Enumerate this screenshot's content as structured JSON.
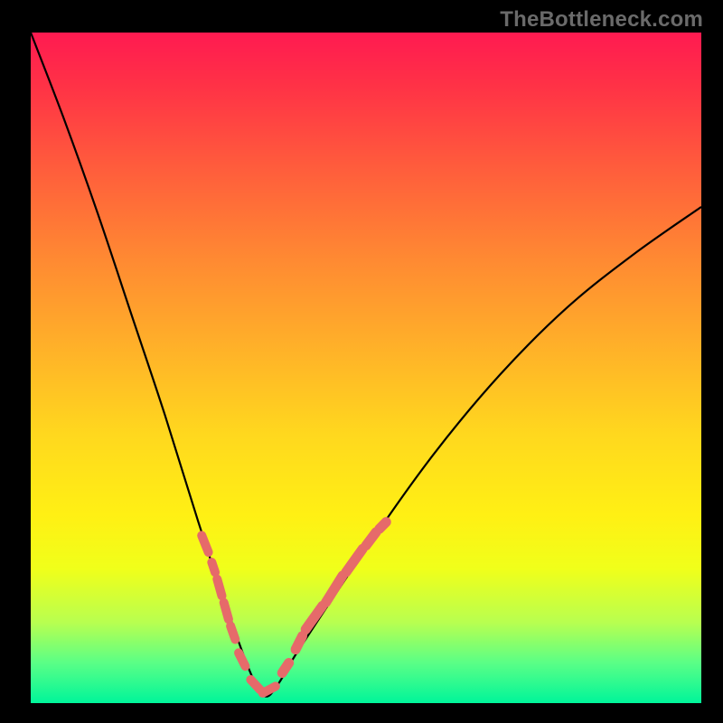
{
  "watermark": "TheBottleneck.com",
  "colors": {
    "gradient_top": "#ff1a51",
    "gradient_bottom": "#00f59a",
    "curve": "#000000",
    "segment": "#e66a6a",
    "frame": "#000000"
  },
  "chart_data": {
    "type": "line",
    "title": "",
    "xlabel": "",
    "ylabel": "",
    "xlim": [
      0,
      100
    ],
    "ylim": [
      0,
      100
    ],
    "x": [
      0,
      5,
      10,
      15,
      20,
      25,
      30,
      33,
      35,
      37,
      40,
      50,
      60,
      70,
      80,
      90,
      100
    ],
    "values": [
      100,
      87,
      73,
      58,
      43,
      27,
      12,
      4,
      1,
      3,
      8,
      23,
      37,
      49,
      59,
      67,
      74
    ],
    "minimum_x": 35,
    "minimum_y": 1,
    "highlight_segments_right": [
      {
        "x0": 37.5,
        "y0": 4.5,
        "x1": 38.5,
        "y1": 6
      },
      {
        "x0": 39.5,
        "y0": 8,
        "x1": 40.5,
        "y1": 10
      },
      {
        "x0": 41,
        "y0": 11,
        "x1": 43.5,
        "y1": 14.5
      },
      {
        "x0": 44,
        "y0": 15,
        "x1": 46.5,
        "y1": 19
      },
      {
        "x0": 47,
        "y0": 19.5,
        "x1": 49.5,
        "y1": 23
      },
      {
        "x0": 50,
        "y0": 23.5,
        "x1": 51.5,
        "y1": 25.5
      },
      {
        "x0": 52,
        "y0": 26,
        "x1": 53,
        "y1": 27
      }
    ],
    "highlight_segments_left": [
      {
        "x0": 25.5,
        "y0": 25,
        "x1": 26.5,
        "y1": 22.5
      },
      {
        "x0": 27,
        "y0": 21,
        "x1": 27.5,
        "y1": 19.5
      },
      {
        "x0": 27.8,
        "y0": 18.5,
        "x1": 28.5,
        "y1": 16
      },
      {
        "x0": 28.8,
        "y0": 15,
        "x1": 29.5,
        "y1": 12.5
      },
      {
        "x0": 29.8,
        "y0": 11.5,
        "x1": 30.5,
        "y1": 9.5
      },
      {
        "x0": 31,
        "y0": 7.5,
        "x1": 32,
        "y1": 5.5
      }
    ],
    "highlight_segments_bottom": [
      {
        "x0": 32.8,
        "y0": 3.5,
        "x1": 34.2,
        "y1": 2
      },
      {
        "x0": 34.6,
        "y0": 1.5,
        "x1": 36.5,
        "y1": 2.5
      }
    ]
  }
}
